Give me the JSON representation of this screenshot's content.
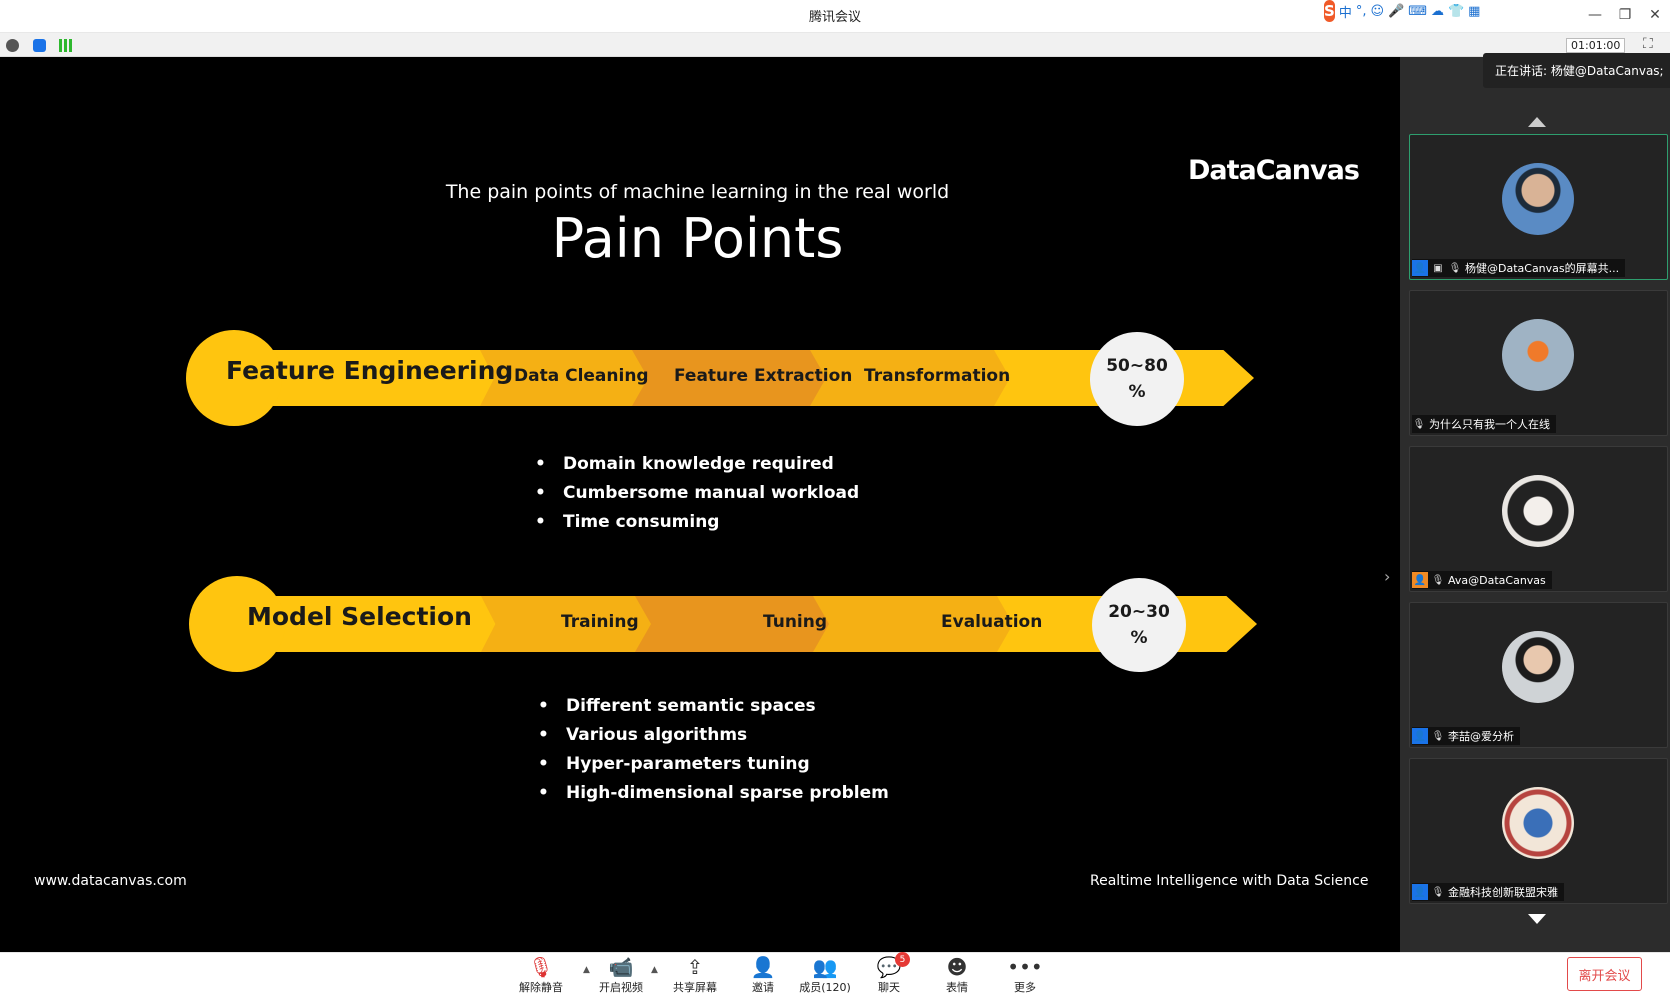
{
  "window": {
    "title": "腾讯会议",
    "minimize": "—",
    "restore": "❐",
    "close": "✕"
  },
  "ime": {
    "logo": "S",
    "lang": "中",
    "icons": [
      "°,",
      "☺",
      "🎤",
      "⌨",
      "☁",
      "👕",
      "▦"
    ]
  },
  "infobar": {
    "timer": "01:01:00"
  },
  "slide": {
    "subtitle": "The pain points of machine learning in the real world",
    "title": "Pain Points",
    "logo": "DataCanvas",
    "rows": [
      {
        "heading": "Feature Engineering",
        "steps": [
          "Data Cleaning",
          "Feature Extraction",
          "Transformation"
        ],
        "percent_top": "50~80",
        "percent_bottom": "%",
        "bullets": [
          "Domain  knowledge required",
          "Cumbersome manual workload",
          "Time consuming"
        ]
      },
      {
        "heading": "Model Selection",
        "steps": [
          "Training",
          "Tuning",
          "Evaluation"
        ],
        "percent_top": "20~30",
        "percent_bottom": "%",
        "bullets": [
          "Different semantic spaces",
          "Various algorithms",
          "Hyper-parameters tuning",
          "High-dimensional  sparse  problem"
        ]
      }
    ],
    "footer_left": "www.datacanvas.com",
    "footer_right": "Realtime Intelligence with Data Science"
  },
  "sidebar": {
    "speaking": "正在讲话: 杨健@DataCanvas;",
    "participants": [
      {
        "name": "杨健@DataCanvas的屏幕共...",
        "host_color": "#1a73e8",
        "active": true
      },
      {
        "name": "为什么只有我一个人在线",
        "host_color": "",
        "active": false
      },
      {
        "name": "Ava@DataCanvas",
        "host_color": "#f08a24",
        "active": false
      },
      {
        "name": "李喆@爱分析",
        "host_color": "#1a73e8",
        "active": false
      },
      {
        "name": "金融科技创新联盟宋雅",
        "host_color": "#1a73e8",
        "active": false
      }
    ]
  },
  "toolbar": {
    "unmute": "解除静音",
    "video": "开启视频",
    "share": "共享屏幕",
    "invite": "邀请",
    "members": "成员(120)",
    "chat": "聊天",
    "chat_badge": "5",
    "emoji": "表情",
    "more": "更多",
    "leave": "离开会议"
  },
  "colors": {
    "accent_yellow": "#ffc50f",
    "accent_orange": "#f0a020",
    "leave_red": "#e24a4a",
    "active_green": "#2e9e6e"
  }
}
